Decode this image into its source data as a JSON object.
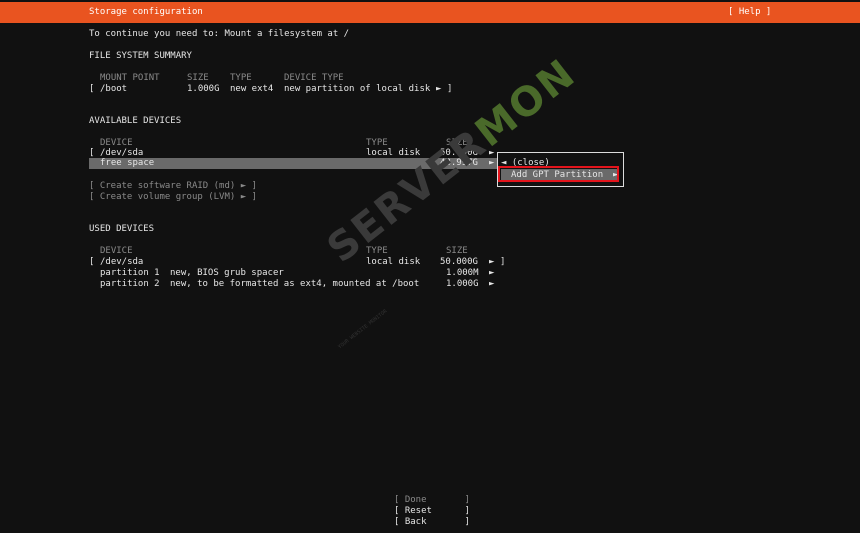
{
  "header": {
    "title": "Storage configuration",
    "help": "[ Help ]"
  },
  "instruction": "To continue you need to: Mount a filesystem at /",
  "fs_summary": {
    "title": "FILE SYSTEM SUMMARY",
    "headers": {
      "mount": "MOUNT POINT",
      "size": "SIZE",
      "type": "TYPE",
      "device_type": "DEVICE TYPE"
    },
    "rows": [
      {
        "open": "[",
        "mount": "/boot",
        "size": "1.000G",
        "type": "new ext4",
        "device_type": "new partition of local disk",
        "arrow": "►",
        "close": "]"
      }
    ]
  },
  "available": {
    "title": "AVAILABLE DEVICES",
    "headers": {
      "device": "DEVICE",
      "type": "TYPE",
      "size": "SIZE"
    },
    "disk": {
      "open": "[",
      "device": "/dev/sda",
      "type": "local disk",
      "size": "50.000G",
      "arrow": "►"
    },
    "free": {
      "device": "free space",
      "size": "48.997G",
      "arrow": "►"
    },
    "actions": [
      "[ Create software RAID (md) ► ]",
      "[ Create volume group (LVM) ► ]"
    ]
  },
  "popup": {
    "close": "◄ (close)",
    "add_gpt": "Add GPT Partition",
    "add_gpt_arrow": "►"
  },
  "used": {
    "title": "USED DEVICES",
    "headers": {
      "device": "DEVICE",
      "type": "TYPE",
      "size": "SIZE"
    },
    "disk": {
      "open": "[",
      "device": "/dev/sda",
      "type": "local disk",
      "size": "50.000G",
      "arrow": "►",
      "close": "]"
    },
    "partitions": [
      {
        "name": "partition 1",
        "desc": "new, BIOS grub spacer",
        "size": "1.000M",
        "arrow": "►"
      },
      {
        "name": "partition 2",
        "desc": "new, to be formatted as ext4, mounted at /boot",
        "size": "1.000G",
        "arrow": "►"
      }
    ]
  },
  "footer": {
    "done": "[ Done       ]",
    "reset": "[ Reset      ]",
    "back": "[ Back       ]"
  },
  "watermark": {
    "left": "SERVER",
    "right": "MON",
    "tagline": "YOUR WEBSITE MONITOR"
  },
  "colors": {
    "header_bg": "#e95420",
    "background": "#111111",
    "highlight": "#6a6a6a",
    "annotation": "#e3141c"
  }
}
